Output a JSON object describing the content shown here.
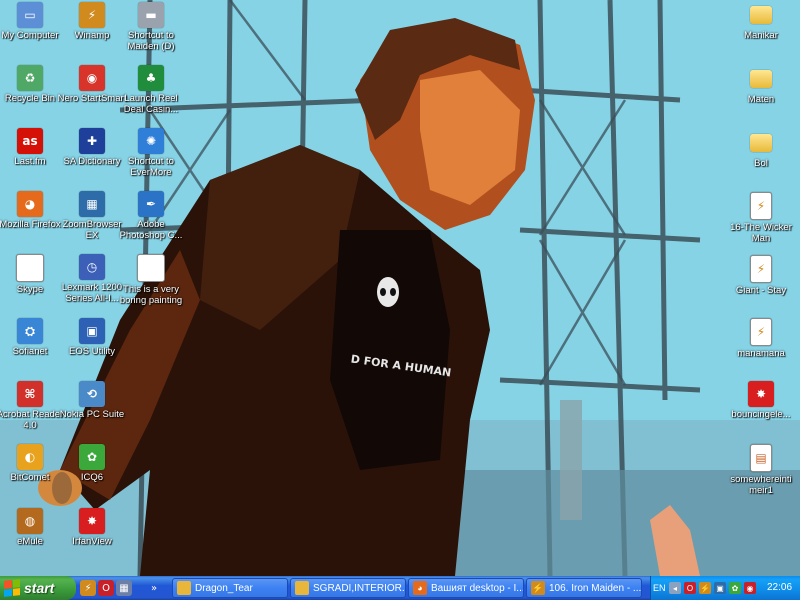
{
  "desktop": {
    "icons_left": [
      {
        "label": "My Computer",
        "icon": "computer-icon",
        "color": "#5d8fd6",
        "glyph": "▭"
      },
      {
        "label": "Winamp",
        "icon": "winamp-icon",
        "color": "#d08a1e",
        "glyph": "⚡"
      },
      {
        "label": "Shortcut to Maiden (D)",
        "icon": "drive-icon",
        "color": "#9aa3ad",
        "glyph": "▬"
      },
      {
        "label": "Recycle Bin",
        "icon": "recycle-bin-icon",
        "color": "#4fa866",
        "glyph": "♻"
      },
      {
        "label": "Nero StartSmart",
        "icon": "nero-icon",
        "color": "#d8342a",
        "glyph": "◉"
      },
      {
        "label": "Launch Reel Deal Casin...",
        "icon": "casino-icon",
        "color": "#1f8d3b",
        "glyph": "♣"
      },
      {
        "label": "Last.fm",
        "icon": "lastfm-icon",
        "color": "#d51007",
        "glyph": "as"
      },
      {
        "label": "SA Dictionary",
        "icon": "uk-flag-icon",
        "color": "#1e3f9a",
        "glyph": "✚"
      },
      {
        "label": "Shortcut to EverMore",
        "icon": "evermore-icon",
        "color": "#2f7fd9",
        "glyph": "✺"
      },
      {
        "label": "Mozilla Firefox",
        "icon": "firefox-icon",
        "color": "#e66a1c",
        "glyph": "◕"
      },
      {
        "label": "ZoomBrowser EX",
        "icon": "zoombrowser-icon",
        "color": "#2d6ca8",
        "glyph": "▦"
      },
      {
        "label": "Adobe Photoshop C...",
        "icon": "photoshop-icon",
        "color": "#2a73c7",
        "glyph": "✒"
      },
      {
        "label": "Skype",
        "icon": "skype-doc-icon",
        "color": "#ffffff",
        "glyph": "≡"
      },
      {
        "label": "Lexmark 1200 Series All-I...",
        "icon": "lexmark-icon",
        "color": "#3c5fb8",
        "glyph": "◷"
      },
      {
        "label": "This is a very boring painting",
        "icon": "word-doc-icon",
        "color": "#ffffff",
        "glyph": "W"
      },
      {
        "label": "Sofianet",
        "icon": "network-icon",
        "color": "#3a86d6",
        "glyph": "⛭"
      },
      {
        "label": "EOS Utility",
        "icon": "eos-utility-icon",
        "color": "#2c61b5",
        "glyph": "▣"
      },
      {
        "label": "Acrobat Reader 4.0",
        "icon": "acrobat-icon",
        "color": "#d2302b",
        "glyph": "⌘"
      },
      {
        "label": "Nokia PC Suite",
        "icon": "nokia-icon",
        "color": "#4a8ac8",
        "glyph": "⟲"
      },
      {
        "label": "BitComet",
        "icon": "bitcomet-icon",
        "color": "#e8a21d",
        "glyph": "◐"
      },
      {
        "label": "ICQ6",
        "icon": "icq-icon",
        "color": "#3aa83a",
        "glyph": "✿"
      },
      {
        "label": "eMule",
        "icon": "emule-icon",
        "color": "#b36a1e",
        "glyph": "◍"
      },
      {
        "label": "IrfanView",
        "icon": "irfanview-icon",
        "color": "#d81e1e",
        "glyph": "✸"
      }
    ],
    "icons_right": [
      {
        "label": "Manikar",
        "icon": "folder-icon"
      },
      {
        "label": "Maten",
        "icon": "folder-icon"
      },
      {
        "label": "Bol",
        "icon": "folder-icon"
      },
      {
        "label": "16-The Wicker Man",
        "icon": "winamp-file-icon"
      },
      {
        "label": "Giant - Stay",
        "icon": "winamp-file-icon"
      },
      {
        "label": "manamana",
        "icon": "winamp-file-icon"
      },
      {
        "label": "bouncingele...",
        "icon": "irfanview-file-icon"
      },
      {
        "label": "somewhereinti meir1",
        "icon": "image-file-icon"
      }
    ]
  },
  "taskbar": {
    "start_label": "start",
    "quick_launch": [
      {
        "icon": "winamp-icon",
        "color": "#d08a1e",
        "glyph": "⚡"
      },
      {
        "icon": "opera-icon",
        "color": "#c8202a",
        "glyph": "O"
      },
      {
        "icon": "calendar-icon",
        "color": "#6c7fa8",
        "glyph": "▦"
      },
      {
        "icon": "chevron-icon",
        "color": "transparent",
        "glyph": "»"
      }
    ],
    "tasks": [
      {
        "label": "Dragon_Tear",
        "icon": "folder-icon",
        "color": "#e7b63a",
        "glyph": ""
      },
      {
        "label": "SGRADI,INTERIOR...",
        "icon": "folder-icon",
        "color": "#e7b63a",
        "glyph": ""
      },
      {
        "label": "Вашият desktop - I...",
        "icon": "firefox-icon",
        "color": "#e66a1c",
        "glyph": "◕"
      },
      {
        "label": "106. Iron Maiden - ...",
        "icon": "winamp-icon",
        "color": "#d08a1e",
        "glyph": "⚡"
      }
    ],
    "tray": {
      "language": "EN",
      "time": "22:06"
    }
  }
}
